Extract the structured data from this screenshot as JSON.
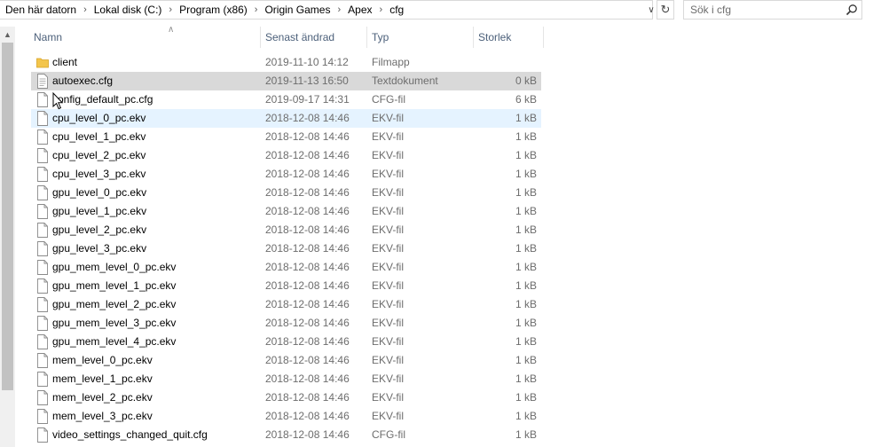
{
  "breadcrumbs": [
    "Den här datorn",
    "Lokal disk (C:)",
    "Program (x86)",
    "Origin Games",
    "Apex",
    "cfg"
  ],
  "search": {
    "placeholder": "Sök i cfg"
  },
  "columns": {
    "name": "Namn",
    "date": "Senast ändrad",
    "type": "Typ",
    "size": "Storlek"
  },
  "files": [
    {
      "name": "client",
      "date": "2019-11-10 14:12",
      "type": "Filmapp",
      "size": "",
      "kind": "folder"
    },
    {
      "name": "autoexec.cfg",
      "date": "2019-11-13 16:50",
      "type": "Textdokument",
      "size": "0 kB",
      "kind": "text",
      "state": "selected"
    },
    {
      "name": "config_default_pc.cfg",
      "date": "2019-09-17 14:31",
      "type": "CFG-fil",
      "size": "6 kB",
      "kind": "file"
    },
    {
      "name": "cpu_level_0_pc.ekv",
      "date": "2018-12-08 14:46",
      "type": "EKV-fil",
      "size": "1 kB",
      "kind": "file",
      "state": "hover"
    },
    {
      "name": "cpu_level_1_pc.ekv",
      "date": "2018-12-08 14:46",
      "type": "EKV-fil",
      "size": "1 kB",
      "kind": "file"
    },
    {
      "name": "cpu_level_2_pc.ekv",
      "date": "2018-12-08 14:46",
      "type": "EKV-fil",
      "size": "1 kB",
      "kind": "file"
    },
    {
      "name": "cpu_level_3_pc.ekv",
      "date": "2018-12-08 14:46",
      "type": "EKV-fil",
      "size": "1 kB",
      "kind": "file"
    },
    {
      "name": "gpu_level_0_pc.ekv",
      "date": "2018-12-08 14:46",
      "type": "EKV-fil",
      "size": "1 kB",
      "kind": "file"
    },
    {
      "name": "gpu_level_1_pc.ekv",
      "date": "2018-12-08 14:46",
      "type": "EKV-fil",
      "size": "1 kB",
      "kind": "file"
    },
    {
      "name": "gpu_level_2_pc.ekv",
      "date": "2018-12-08 14:46",
      "type": "EKV-fil",
      "size": "1 kB",
      "kind": "file"
    },
    {
      "name": "gpu_level_3_pc.ekv",
      "date": "2018-12-08 14:46",
      "type": "EKV-fil",
      "size": "1 kB",
      "kind": "file"
    },
    {
      "name": "gpu_mem_level_0_pc.ekv",
      "date": "2018-12-08 14:46",
      "type": "EKV-fil",
      "size": "1 kB",
      "kind": "file"
    },
    {
      "name": "gpu_mem_level_1_pc.ekv",
      "date": "2018-12-08 14:46",
      "type": "EKV-fil",
      "size": "1 kB",
      "kind": "file"
    },
    {
      "name": "gpu_mem_level_2_pc.ekv",
      "date": "2018-12-08 14:46",
      "type": "EKV-fil",
      "size": "1 kB",
      "kind": "file"
    },
    {
      "name": "gpu_mem_level_3_pc.ekv",
      "date": "2018-12-08 14:46",
      "type": "EKV-fil",
      "size": "1 kB",
      "kind": "file"
    },
    {
      "name": "gpu_mem_level_4_pc.ekv",
      "date": "2018-12-08 14:46",
      "type": "EKV-fil",
      "size": "1 kB",
      "kind": "file"
    },
    {
      "name": "mem_level_0_pc.ekv",
      "date": "2018-12-08 14:46",
      "type": "EKV-fil",
      "size": "1 kB",
      "kind": "file"
    },
    {
      "name": "mem_level_1_pc.ekv",
      "date": "2018-12-08 14:46",
      "type": "EKV-fil",
      "size": "1 kB",
      "kind": "file"
    },
    {
      "name": "mem_level_2_pc.ekv",
      "date": "2018-12-08 14:46",
      "type": "EKV-fil",
      "size": "1 kB",
      "kind": "file"
    },
    {
      "name": "mem_level_3_pc.ekv",
      "date": "2018-12-08 14:46",
      "type": "EKV-fil",
      "size": "1 kB",
      "kind": "file"
    },
    {
      "name": "video_settings_changed_quit.cfg",
      "date": "2018-12-08 14:46",
      "type": "CFG-fil",
      "size": "1 kB",
      "kind": "file"
    }
  ],
  "colors": {
    "folder": "#f3c54b",
    "selected": "#d9d9d9",
    "hover": "#e5f3ff",
    "header_text": "#4c607a",
    "meta_text": "#6d6d6d"
  },
  "icons": {
    "folder": "folder-icon",
    "file": "file-icon",
    "text": "text-file-icon",
    "search": "search-icon",
    "refresh": "refresh-icon"
  }
}
